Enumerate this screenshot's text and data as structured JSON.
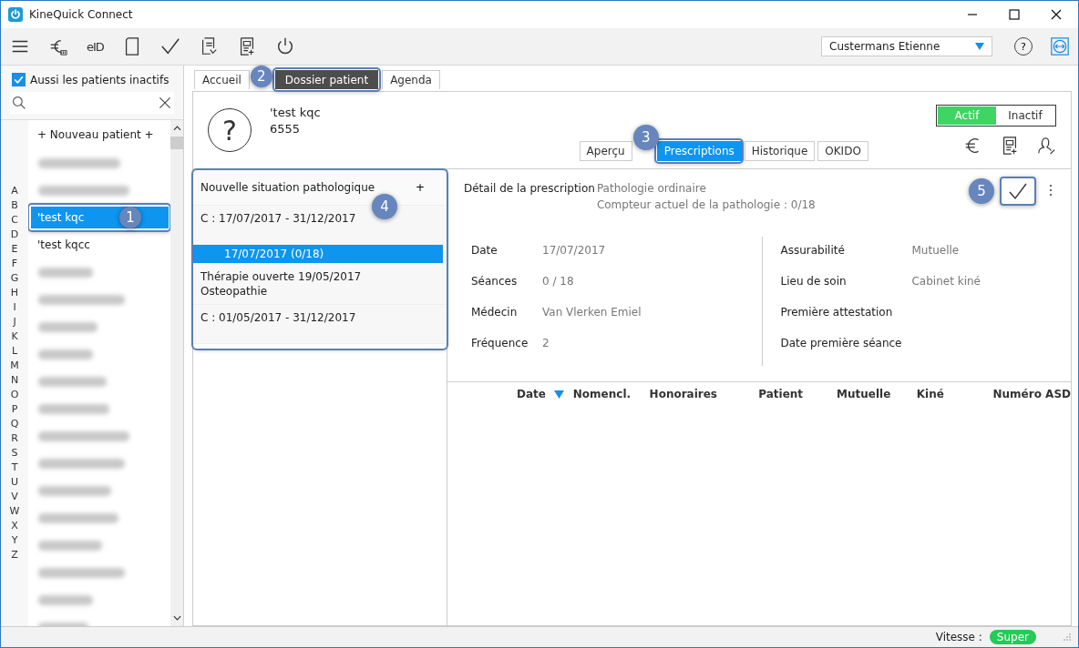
{
  "window": {
    "title": "KineQuick Connect"
  },
  "toolbar": {
    "eid_label": "eID",
    "user": "Custermans Etienne",
    "help": "?"
  },
  "sidebar": {
    "inactive_filter": {
      "label": "Aussi les patients inactifs",
      "checked": true
    },
    "new_patient": "+ Nouveau patient +",
    "letters": [
      "A",
      "B",
      "C",
      "D",
      "E",
      "F",
      "G",
      "H",
      "I",
      "J",
      "K",
      "L",
      "M",
      "N",
      "O",
      "P",
      "Q",
      "R",
      "S",
      "T",
      "U",
      "V",
      "W",
      "X",
      "Y",
      "Z"
    ],
    "patients": [
      {
        "blurred": true,
        "selected": false
      },
      {
        "blurred": true,
        "selected": false
      },
      {
        "name": "'test kqc",
        "blurred": false,
        "selected": true,
        "callout": "1"
      },
      {
        "name": "'test kqcc",
        "blurred": false,
        "selected": false
      },
      {
        "blurred": true,
        "selected": false
      },
      {
        "blurred": true,
        "selected": false
      },
      {
        "blurred": true,
        "selected": false
      },
      {
        "blurred": true,
        "selected": false
      },
      {
        "blurred": true,
        "selected": false
      },
      {
        "blurred": true,
        "selected": false
      },
      {
        "blurred": true,
        "selected": false
      },
      {
        "blurred": true,
        "selected": false
      },
      {
        "blurred": true,
        "selected": false
      },
      {
        "blurred": true,
        "selected": false
      },
      {
        "blurred": true,
        "selected": false
      },
      {
        "blurred": true,
        "selected": false
      },
      {
        "blurred": true,
        "selected": false
      },
      {
        "blurred": true,
        "selected": false
      }
    ]
  },
  "tabs": [
    {
      "label": "Accueil",
      "selected": false
    },
    {
      "label": "Dossier patient",
      "selected": true,
      "callout": "2"
    },
    {
      "label": "Agenda",
      "selected": false
    }
  ],
  "patient": {
    "name": "'test kqc",
    "number": "6555",
    "avatar": "?"
  },
  "subtabs": [
    {
      "label": "Aperçu",
      "selected": false
    },
    {
      "label": "Prescriptions",
      "selected": true,
      "callout": "3"
    },
    {
      "label": "Historique",
      "selected": false
    },
    {
      "label": "OKIDO",
      "selected": false
    }
  ],
  "status_toggle": [
    {
      "label": "Actif",
      "selected": true
    },
    {
      "label": "Inactif",
      "selected": false
    }
  ],
  "situations": {
    "callout": "4",
    "title": "Nouvelle situation pathologique",
    "add": "+",
    "entries": [
      {
        "kind": "period",
        "lines": [
          "C : 17/07/2017 - 31/12/2017"
        ],
        "selected": false
      },
      {
        "kind": "prescription",
        "lines": [
          "17/07/2017  (0/18)"
        ],
        "selected": true
      },
      {
        "kind": "therapy",
        "lines": [
          "Thérapie ouverte 19/05/2017",
          "Osteopathie"
        ],
        "selected": false
      },
      {
        "kind": "period",
        "lines": [
          "C : 01/05/2017 - 31/12/2017"
        ],
        "selected": false
      }
    ]
  },
  "detail": {
    "label": "Détail de la prescription",
    "type": "Pathologie ordinaire",
    "counter": "Compteur actuel de la pathologie : 0/18",
    "validate_callout": "5",
    "left": [
      {
        "label": "Date",
        "value": "17/07/2017"
      },
      {
        "label": "Séances",
        "value": "0 / 18"
      },
      {
        "label": "Médecin",
        "value": "Van Vlerken Emiel"
      },
      {
        "label": "Fréquence",
        "value": "2"
      }
    ],
    "right": [
      {
        "label": "Assurabilité",
        "value": "Mutuelle"
      },
      {
        "label": "Lieu de soin",
        "value": "Cabinet kiné"
      },
      {
        "label": "Première attestation"
      },
      {
        "label": "Date première séance"
      }
    ]
  },
  "table": {
    "columns": [
      {
        "label": "Date",
        "sorted": true
      },
      {
        "label": "Nomencl.",
        "sorted": false
      },
      {
        "label": "Honoraires",
        "sorted": false
      },
      {
        "label": "Patient",
        "sorted": false
      },
      {
        "label": "Mutuelle",
        "sorted": false
      },
      {
        "label": "Kiné",
        "sorted": false
      },
      {
        "label": "Numéro ASD",
        "sorted": false
      }
    ]
  },
  "status_bar": {
    "label": "Vitesse :",
    "speed": "Super"
  }
}
